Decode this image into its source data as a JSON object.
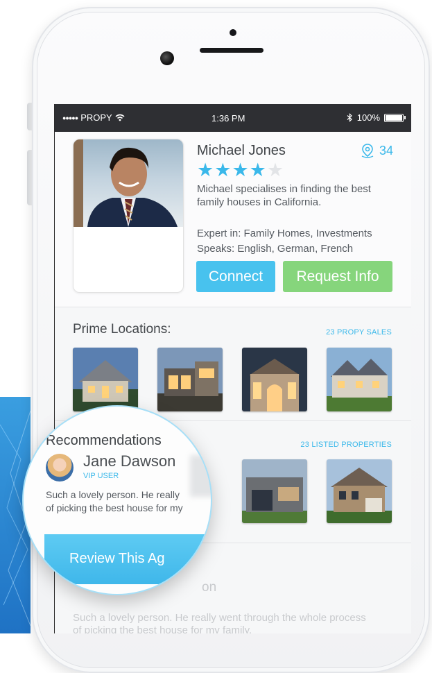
{
  "status_bar": {
    "carrier": "PROPY",
    "time": "1:36 PM",
    "battery": "100%"
  },
  "agent": {
    "name": "Michael Jones",
    "location_count": "34",
    "rating": 4,
    "rating_max": 5,
    "bio": "Michael specialises in finding the best family houses in California.",
    "expert_label": "Expert in:",
    "expert_value": "Family Homes, Investments",
    "speaks_label": "Speaks:",
    "speaks_value": "English, German, French"
  },
  "actions": {
    "connect": "Connect",
    "request_info": "Request Info"
  },
  "prime_locations": {
    "title": "Prime Locations:",
    "link": "23 PROPY SALES"
  },
  "listed": {
    "link": "23 LISTED PROPERTIES"
  },
  "recommendations": {
    "title": "Recommendations",
    "reviewer_name": "Jane Dawson",
    "reviewer_badge": "VIP USER",
    "review_line1": "Such a lovely person. He really",
    "review_line2": "of picking the best house for my",
    "review_button": "Review This Ag"
  },
  "background_fragments": {
    "name_fragment": "on",
    "review_line1": "Such a lovely person. He really went through the whole process",
    "review_line2": "of picking the best house for my family."
  },
  "colors": {
    "accent_blue": "#48c2ee",
    "accent_green": "#86d57c",
    "star_filled": "#3ab8ea",
    "star_empty": "#e2e4e7"
  },
  "icons": [
    "wifi-icon",
    "bluetooth-icon",
    "battery-icon",
    "location-pin-icon",
    "star-icon"
  ]
}
